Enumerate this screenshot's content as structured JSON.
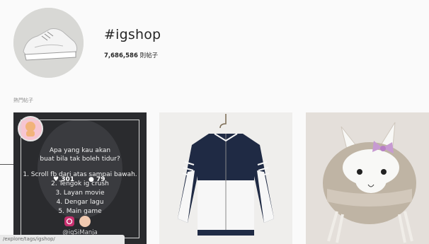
{
  "header": {
    "hashtag": "#igshop",
    "post_count": "7,686,586",
    "post_count_unit": "則帖子"
  },
  "section_label": "熱門帖子",
  "posts": [
    {
      "lines": [
        "Apa yang kau akan",
        "buat bila tak boleh tidur?",
        "1. Scroll fb dari atas sampai bawah.",
        "2. Tengok ig crush",
        "3. Layan movie",
        "4. Dengar lagu",
        "5. Main game"
      ],
      "handle": "@igSiManja",
      "likes": "301",
      "comments": "79"
    },
    {
      "description": "navy white jacket"
    },
    {
      "description": "crochet llama hat"
    }
  ],
  "status_url": "/explore/tags/igshop/"
}
